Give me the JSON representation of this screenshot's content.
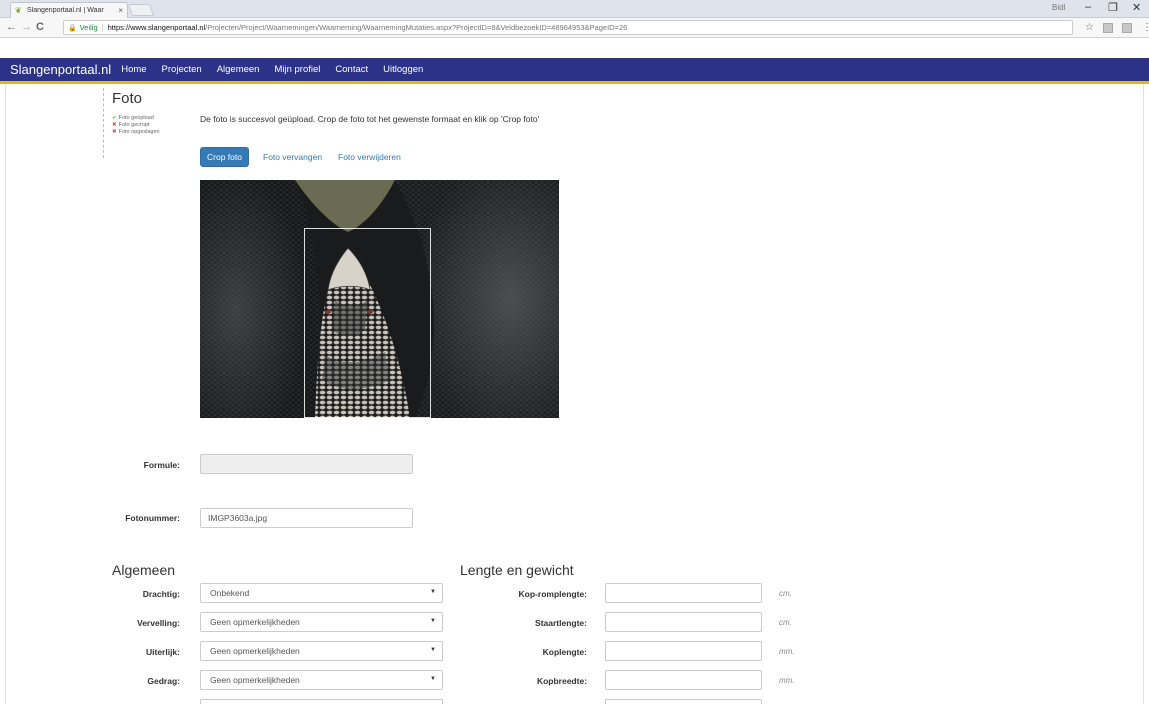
{
  "browser": {
    "tab_title": "Slangenportaal.nl | Waar",
    "tab_close": "×",
    "user_label": "Bidl",
    "minimize": "–",
    "maximize": "❐",
    "close": "✕",
    "secure_label": "Veilig",
    "url_host": "https://www.slangenportaal.nl",
    "url_path": "/Projecten/Project/Waarnemingen/Waarneming/WaarnemingMutaties.aspx?ProjectID=8&VeldbezoekID=48964953&PageID=26"
  },
  "sitenav": {
    "brand": "Slangenportaal.nl",
    "links": [
      "Home",
      "Projecten",
      "Algemeen",
      "Mijn profiel",
      "Contact",
      "Uitloggen"
    ]
  },
  "foto": {
    "title": "Foto",
    "steps": [
      {
        "status": "done",
        "label": "Foto geüpload"
      },
      {
        "status": "todo",
        "label": "Foto gecropt"
      },
      {
        "status": "todo",
        "label": "Foto opgeslagen"
      }
    ],
    "message": "De foto is succesvol geüpload. Crop de foto tot het gewenste formaat en klik op 'Crop foto'",
    "crop_button": "Crop foto",
    "replace_link": "Foto vervangen",
    "delete_link": "Foto verwijderen"
  },
  "form": {
    "formule_label": "Formule:",
    "formule_value": "",
    "fotonummer_label": "Fotonummer:",
    "fotonummer_value": "IMGP3603a.jpg"
  },
  "algemeen": {
    "title": "Algemeen",
    "fields": [
      {
        "label": "Drachtig:",
        "value": "Onbekend"
      },
      {
        "label": "Vervelling:",
        "value": "Geen opmerkelijkheden"
      },
      {
        "label": "Uiterlijk:",
        "value": "Geen opmerkelijkheden"
      },
      {
        "label": "Gedrag:",
        "value": "Geen opmerkelijkheden"
      }
    ]
  },
  "lengte": {
    "title": "Lengte en gewicht",
    "fields": [
      {
        "label": "Kop-romplengte:",
        "value": "",
        "unit": "cm."
      },
      {
        "label": "Staartlengte:",
        "value": "",
        "unit": "cm."
      },
      {
        "label": "Koplengte:",
        "value": "",
        "unit": "mm."
      },
      {
        "label": "Kopbreedte:",
        "value": "",
        "unit": "mm."
      }
    ]
  },
  "icons": {
    "back": "←",
    "forward": "→",
    "reload": "C",
    "star": "☆",
    "menu": "⋮",
    "step_done": "✔",
    "step_todo": "✖",
    "caret": "▼"
  }
}
